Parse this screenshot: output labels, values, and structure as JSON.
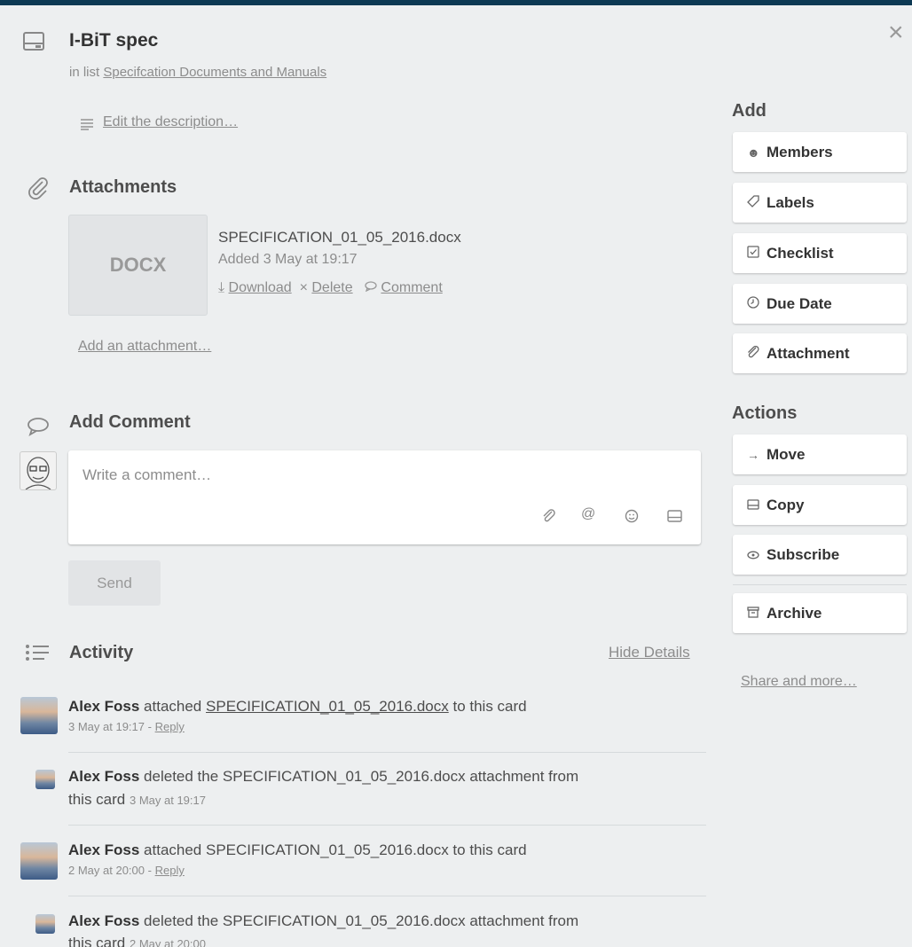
{
  "card": {
    "title": "I-BiT spec",
    "in_list_prefix": "in list",
    "list_name": "Specifcation Documents and Manuals",
    "edit_description": "Edit the description…"
  },
  "attachments": {
    "title": "Attachments",
    "thumb_label": "DOCX",
    "file_name": "SPECIFICATION_01_05_2016.docx",
    "added": "Added 3 May at 19:17",
    "download": "Download",
    "delete": "Delete",
    "comment": "Comment",
    "add_attachment": "Add an attachment…"
  },
  "add_comment": {
    "title": "Add Comment",
    "placeholder": "Write a comment…",
    "send": "Send"
  },
  "activity": {
    "title": "Activity",
    "hide_details": "Hide Details",
    "items": [
      {
        "user": "Alex Foss",
        "pre": "attached",
        "link": "SPECIFICATION_01_05_2016.docx",
        "post": "to this card",
        "time": "3 May at 19:17",
        "sep": "-",
        "reply": "Reply"
      },
      {
        "user": "Alex Foss",
        "line1": "deleted the SPECIFICATION_01_05_2016.docx attachment from",
        "line2": "this card",
        "time": "3 May at 19:17"
      },
      {
        "user": "Alex Foss",
        "pre": "attached SPECIFICATION_01_05_2016.docx to this card",
        "time": "2 May at 20:00",
        "sep": "-",
        "reply": "Reply"
      },
      {
        "user": "Alex Foss",
        "line1": "deleted the SPECIFICATION_01_05_2016.docx attachment from",
        "line2": "this card",
        "time": "2 May at 20:00"
      }
    ]
  },
  "sidebar": {
    "add_title": "Add",
    "add_buttons": [
      {
        "label": "Members",
        "icon": "person-icon"
      },
      {
        "label": "Labels",
        "icon": "tag-icon"
      },
      {
        "label": "Checklist",
        "icon": "checkbox-icon"
      },
      {
        "label": "Due Date",
        "icon": "clock-icon"
      },
      {
        "label": "Attachment",
        "icon": "paperclip-icon"
      }
    ],
    "actions_title": "Actions",
    "action_buttons": [
      {
        "label": "Move",
        "icon": "arrow-right-icon"
      },
      {
        "label": "Copy",
        "icon": "card-icon"
      },
      {
        "label": "Subscribe",
        "icon": "eye-icon"
      },
      {
        "label": "Archive",
        "icon": "archive-icon"
      }
    ],
    "share": "Share and more…"
  },
  "colors": {
    "top_bar": "#0c3953",
    "background": "#edeff0"
  }
}
